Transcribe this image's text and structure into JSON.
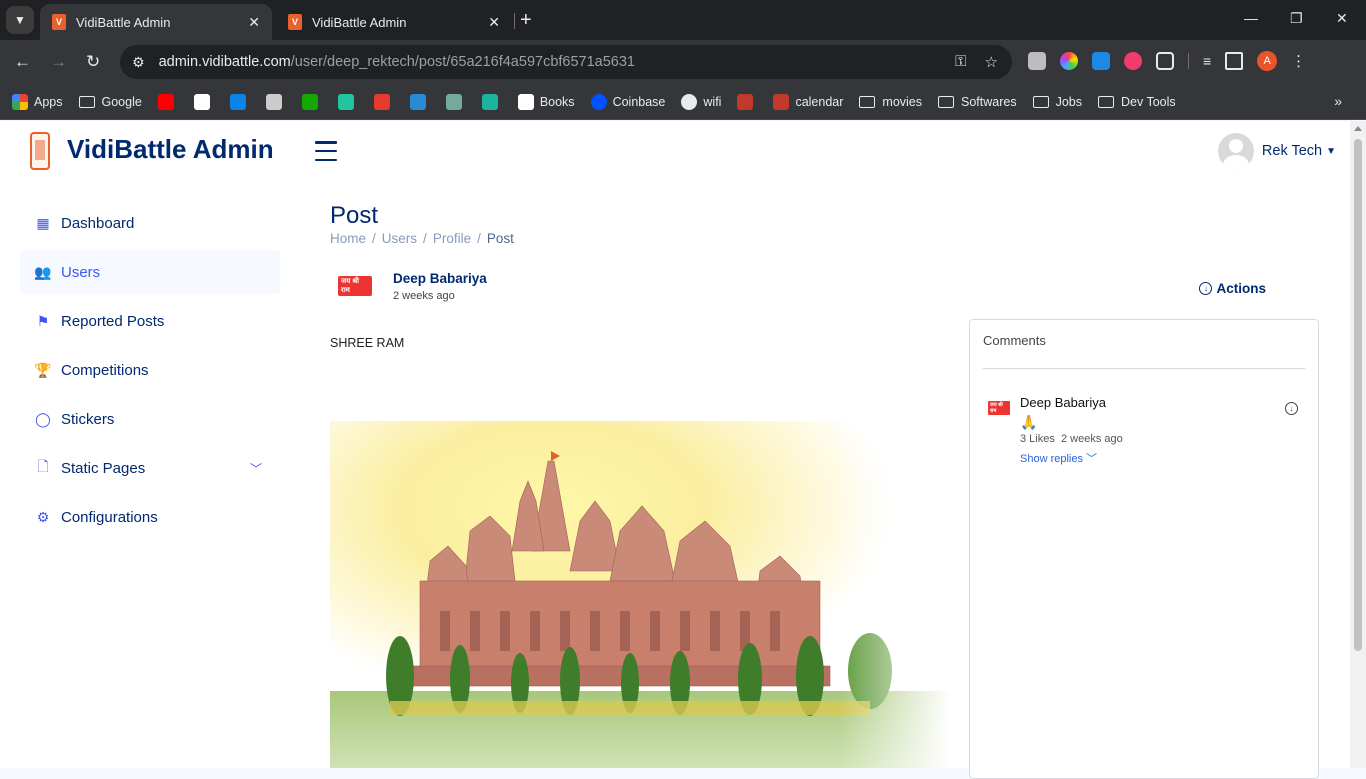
{
  "browser": {
    "tabs": [
      {
        "label": "VidiBattle Admin",
        "active": true
      },
      {
        "label": "VidiBattle Admin",
        "active": false
      }
    ],
    "url_host": "admin.vidibattle.com",
    "url_path": "/user/deep_rektech/post/65a216f4a597cbf6571a5631",
    "bookmarks": [
      {
        "label": "Apps",
        "icon": "apps-grid-icon"
      },
      {
        "label": "Google",
        "icon": "folder-icon"
      },
      {
        "label": "",
        "icon": "youtube-icon",
        "color": "#ff0000"
      },
      {
        "label": "",
        "icon": "github-icon",
        "color": "#ffffff"
      },
      {
        "label": "",
        "icon": "onedrive-icon",
        "color": "#0a84e6"
      },
      {
        "label": "",
        "icon": "pen-icon",
        "color": "#cccccc"
      },
      {
        "label": "",
        "icon": "upwork-icon",
        "color": "#14a800"
      },
      {
        "label": "",
        "icon": "d-icon",
        "color": "#1fc59f"
      },
      {
        "label": "",
        "icon": "p-icon",
        "color": "#e63b2e"
      },
      {
        "label": "",
        "icon": "vscode-icon",
        "color": "#2a8ad4"
      },
      {
        "label": "",
        "icon": "chatgpt-icon",
        "color": "#74aa9c"
      },
      {
        "label": "",
        "icon": "es-icon",
        "color": "#1cb39a"
      },
      {
        "label": "Books",
        "icon": "books-icon"
      },
      {
        "label": "Coinbase",
        "icon": "coinbase-icon"
      },
      {
        "label": "wifi",
        "icon": "globe-icon"
      },
      {
        "label": "",
        "icon": "red-logo-icon",
        "color": "#c0392b"
      },
      {
        "label": "calendar",
        "icon": "calendar-logo-icon"
      },
      {
        "label": "movies",
        "icon": "folder-icon"
      },
      {
        "label": "Softwares",
        "icon": "folder-icon"
      },
      {
        "label": "Jobs",
        "icon": "folder-icon"
      },
      {
        "label": "Dev Tools",
        "icon": "folder-icon"
      }
    ],
    "profile_initial": "A"
  },
  "header": {
    "brand": "VidiBattle Admin",
    "user_name": "Rek Tech"
  },
  "sidebar": {
    "items": [
      {
        "label": "Dashboard",
        "icon": "grid-icon"
      },
      {
        "label": "Users",
        "icon": "people-icon"
      },
      {
        "label": "Reported Posts",
        "icon": "flag-icon"
      },
      {
        "label": "Competitions",
        "icon": "trophy-icon"
      },
      {
        "label": "Stickers",
        "icon": "circle-icon"
      },
      {
        "label": "Static Pages",
        "icon": "file-icon"
      },
      {
        "label": "Configurations",
        "icon": "gear-icon"
      }
    ]
  },
  "main": {
    "title": "Post",
    "breadcrumb": [
      "Home",
      "Users",
      "Profile",
      "Post"
    ],
    "post": {
      "author": "Deep Babariya",
      "time": "2 weeks ago",
      "avatar_text": "जय श्री राम",
      "actions_label": "Actions",
      "caption": "SHREE RAM"
    },
    "comments": {
      "title": "Comments",
      "items": [
        {
          "author": "Deep Babariya",
          "emoji": "🙏",
          "likes": "3 Likes",
          "time": "2 weeks ago",
          "show_replies": "Show replies"
        }
      ]
    }
  }
}
